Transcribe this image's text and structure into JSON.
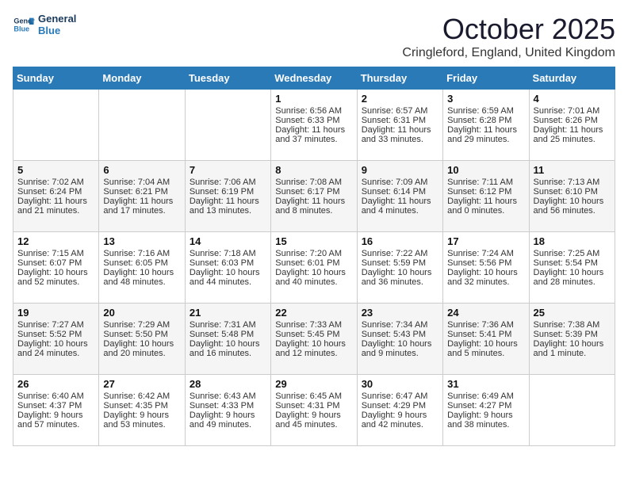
{
  "logo": {
    "line1": "General",
    "line2": "Blue"
  },
  "header": {
    "month": "October 2025",
    "location": "Cringleford, England, United Kingdom"
  },
  "weekdays": [
    "Sunday",
    "Monday",
    "Tuesday",
    "Wednesday",
    "Thursday",
    "Friday",
    "Saturday"
  ],
  "weeks": [
    [
      {
        "day": "",
        "sunrise": "",
        "sunset": "",
        "daylight": ""
      },
      {
        "day": "",
        "sunrise": "",
        "sunset": "",
        "daylight": ""
      },
      {
        "day": "",
        "sunrise": "",
        "sunset": "",
        "daylight": ""
      },
      {
        "day": "1",
        "sunrise": "Sunrise: 6:56 AM",
        "sunset": "Sunset: 6:33 PM",
        "daylight": "Daylight: 11 hours and 37 minutes."
      },
      {
        "day": "2",
        "sunrise": "Sunrise: 6:57 AM",
        "sunset": "Sunset: 6:31 PM",
        "daylight": "Daylight: 11 hours and 33 minutes."
      },
      {
        "day": "3",
        "sunrise": "Sunrise: 6:59 AM",
        "sunset": "Sunset: 6:28 PM",
        "daylight": "Daylight: 11 hours and 29 minutes."
      },
      {
        "day": "4",
        "sunrise": "Sunrise: 7:01 AM",
        "sunset": "Sunset: 6:26 PM",
        "daylight": "Daylight: 11 hours and 25 minutes."
      }
    ],
    [
      {
        "day": "5",
        "sunrise": "Sunrise: 7:02 AM",
        "sunset": "Sunset: 6:24 PM",
        "daylight": "Daylight: 11 hours and 21 minutes."
      },
      {
        "day": "6",
        "sunrise": "Sunrise: 7:04 AM",
        "sunset": "Sunset: 6:21 PM",
        "daylight": "Daylight: 11 hours and 17 minutes."
      },
      {
        "day": "7",
        "sunrise": "Sunrise: 7:06 AM",
        "sunset": "Sunset: 6:19 PM",
        "daylight": "Daylight: 11 hours and 13 minutes."
      },
      {
        "day": "8",
        "sunrise": "Sunrise: 7:08 AM",
        "sunset": "Sunset: 6:17 PM",
        "daylight": "Daylight: 11 hours and 8 minutes."
      },
      {
        "day": "9",
        "sunrise": "Sunrise: 7:09 AM",
        "sunset": "Sunset: 6:14 PM",
        "daylight": "Daylight: 11 hours and 4 minutes."
      },
      {
        "day": "10",
        "sunrise": "Sunrise: 7:11 AM",
        "sunset": "Sunset: 6:12 PM",
        "daylight": "Daylight: 11 hours and 0 minutes."
      },
      {
        "day": "11",
        "sunrise": "Sunrise: 7:13 AM",
        "sunset": "Sunset: 6:10 PM",
        "daylight": "Daylight: 10 hours and 56 minutes."
      }
    ],
    [
      {
        "day": "12",
        "sunrise": "Sunrise: 7:15 AM",
        "sunset": "Sunset: 6:07 PM",
        "daylight": "Daylight: 10 hours and 52 minutes."
      },
      {
        "day": "13",
        "sunrise": "Sunrise: 7:16 AM",
        "sunset": "Sunset: 6:05 PM",
        "daylight": "Daylight: 10 hours and 48 minutes."
      },
      {
        "day": "14",
        "sunrise": "Sunrise: 7:18 AM",
        "sunset": "Sunset: 6:03 PM",
        "daylight": "Daylight: 10 hours and 44 minutes."
      },
      {
        "day": "15",
        "sunrise": "Sunrise: 7:20 AM",
        "sunset": "Sunset: 6:01 PM",
        "daylight": "Daylight: 10 hours and 40 minutes."
      },
      {
        "day": "16",
        "sunrise": "Sunrise: 7:22 AM",
        "sunset": "Sunset: 5:59 PM",
        "daylight": "Daylight: 10 hours and 36 minutes."
      },
      {
        "day": "17",
        "sunrise": "Sunrise: 7:24 AM",
        "sunset": "Sunset: 5:56 PM",
        "daylight": "Daylight: 10 hours and 32 minutes."
      },
      {
        "day": "18",
        "sunrise": "Sunrise: 7:25 AM",
        "sunset": "Sunset: 5:54 PM",
        "daylight": "Daylight: 10 hours and 28 minutes."
      }
    ],
    [
      {
        "day": "19",
        "sunrise": "Sunrise: 7:27 AM",
        "sunset": "Sunset: 5:52 PM",
        "daylight": "Daylight: 10 hours and 24 minutes."
      },
      {
        "day": "20",
        "sunrise": "Sunrise: 7:29 AM",
        "sunset": "Sunset: 5:50 PM",
        "daylight": "Daylight: 10 hours and 20 minutes."
      },
      {
        "day": "21",
        "sunrise": "Sunrise: 7:31 AM",
        "sunset": "Sunset: 5:48 PM",
        "daylight": "Daylight: 10 hours and 16 minutes."
      },
      {
        "day": "22",
        "sunrise": "Sunrise: 7:33 AM",
        "sunset": "Sunset: 5:45 PM",
        "daylight": "Daylight: 10 hours and 12 minutes."
      },
      {
        "day": "23",
        "sunrise": "Sunrise: 7:34 AM",
        "sunset": "Sunset: 5:43 PM",
        "daylight": "Daylight: 10 hours and 9 minutes."
      },
      {
        "day": "24",
        "sunrise": "Sunrise: 7:36 AM",
        "sunset": "Sunset: 5:41 PM",
        "daylight": "Daylight: 10 hours and 5 minutes."
      },
      {
        "day": "25",
        "sunrise": "Sunrise: 7:38 AM",
        "sunset": "Sunset: 5:39 PM",
        "daylight": "Daylight: 10 hours and 1 minute."
      }
    ],
    [
      {
        "day": "26",
        "sunrise": "Sunrise: 6:40 AM",
        "sunset": "Sunset: 4:37 PM",
        "daylight": "Daylight: 9 hours and 57 minutes."
      },
      {
        "day": "27",
        "sunrise": "Sunrise: 6:42 AM",
        "sunset": "Sunset: 4:35 PM",
        "daylight": "Daylight: 9 hours and 53 minutes."
      },
      {
        "day": "28",
        "sunrise": "Sunrise: 6:43 AM",
        "sunset": "Sunset: 4:33 PM",
        "daylight": "Daylight: 9 hours and 49 minutes."
      },
      {
        "day": "29",
        "sunrise": "Sunrise: 6:45 AM",
        "sunset": "Sunset: 4:31 PM",
        "daylight": "Daylight: 9 hours and 45 minutes."
      },
      {
        "day": "30",
        "sunrise": "Sunrise: 6:47 AM",
        "sunset": "Sunset: 4:29 PM",
        "daylight": "Daylight: 9 hours and 42 minutes."
      },
      {
        "day": "31",
        "sunrise": "Sunrise: 6:49 AM",
        "sunset": "Sunset: 4:27 PM",
        "daylight": "Daylight: 9 hours and 38 minutes."
      },
      {
        "day": "",
        "sunrise": "",
        "sunset": "",
        "daylight": ""
      }
    ]
  ]
}
